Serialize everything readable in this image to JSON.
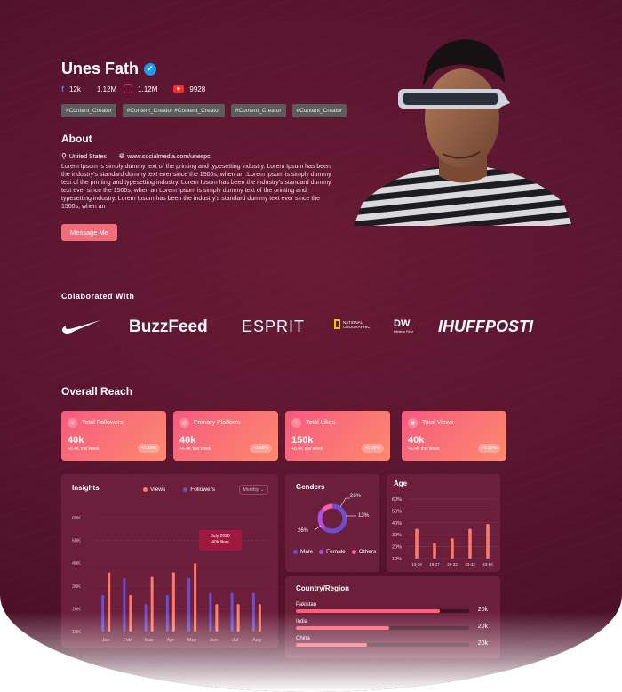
{
  "profile": {
    "name": "Unes Fath",
    "stats": {
      "facebook": "12k",
      "twitter": "1.12M",
      "instagram": "1.12M",
      "youtube": "9928"
    },
    "tags": [
      "#Content_Creator",
      "#Content_Creator",
      "#Content_Creator",
      "#Content_Creator",
      "#Content_Creator"
    ],
    "about_title": "About",
    "location": "United States",
    "website": "www.socialmedia.com/unespc",
    "about_text": "Lorem Ipsum is simply dummy text of the printing and typesetting industry. Lorem Ipsum has been the industry's standard dummy text ever since the 1500s, when an .Lorem Ipsum is simply dummy text of the printing and typesetting industry. Lorem Ipsum has been the industry's standard dummy text ever since the 1500s, when an Lorem Ipsum is simply dummy text of the printing and typesetting industry. Lorem Ipsum has been the industry's standard dummy text ever since the 1500s, when an",
    "message_button": "Message Me"
  },
  "collab": {
    "title": "Colaborated With",
    "brands": [
      "BuzzFeed",
      "ESPRIT",
      "NATIONAL GEOGRAPHIC",
      "DW",
      "IHUFFPOSTI"
    ],
    "brand_sub": {
      "natgeo": "NATIONAL GEOGRAPHIC",
      "dw_sub": "Fitness First"
    }
  },
  "reach": {
    "title": "Overall Reach",
    "kpis": [
      {
        "label": "Total Followers",
        "value": "40k",
        "sub": "+6.4K this week",
        "chip": "+1.29%"
      },
      {
        "label": "Primary Platform",
        "value": "40k",
        "sub": "+6.4K this week",
        "chip": "+1.29%"
      },
      {
        "label": "Total Likes",
        "value": "150k",
        "sub": "+6.4K this week",
        "chip": "+1.29%"
      },
      {
        "label": "Total Views",
        "value": "40k",
        "sub": "+6.4K this week",
        "chip": "+1.29%"
      }
    ]
  },
  "insights": {
    "title": "Insights",
    "legend_views": "Views",
    "legend_followers": "Followers",
    "dropdown": "Monthly",
    "tooltip_title": "July 2020",
    "tooltip_value": "40k likes"
  },
  "genders": {
    "title": "Genders",
    "labels": [
      "Male",
      "Female",
      "Others"
    ],
    "pct_top": "26%",
    "pct_right": "13%",
    "pct_left": "26%"
  },
  "age": {
    "title": "Age"
  },
  "country": {
    "title": "Country/Region",
    "rows": [
      {
        "name": "Pakistan",
        "value": "20k",
        "fill": 0.83
      },
      {
        "name": "India",
        "value": "20k",
        "fill": 0.54
      },
      {
        "name": "China",
        "value": "20k",
        "fill": 0.41
      }
    ]
  },
  "colors": {
    "views": "#ff7a6b",
    "followers": "#6b4fd1",
    "accent": "#f65a7e",
    "male": "#6b4fd1",
    "female": "#b04fe0",
    "others": "#ff5fb0"
  },
  "chart_data": [
    {
      "type": "bar",
      "title": "Insights",
      "categories": [
        "Jan",
        "Feb",
        "Mar",
        "Apr",
        "May",
        "Jun",
        "Jul",
        "Aug"
      ],
      "yticks": [
        "10K",
        "20K",
        "30K",
        "40K",
        "50K",
        "60K"
      ],
      "ylim": [
        10,
        60
      ],
      "series": [
        {
          "name": "Followers",
          "values": [
            26,
            33.5,
            22,
            26,
            33.5,
            27,
            27,
            27
          ]
        },
        {
          "name": "Views",
          "values": [
            36,
            26,
            34,
            36,
            40,
            22,
            22,
            22
          ]
        }
      ],
      "grid": true
    },
    {
      "type": "bar",
      "title": "Age",
      "categories": [
        "13-18",
        "19-27",
        "28-32",
        "33-42",
        "43-56"
      ],
      "yticks": [
        "10%",
        "20%",
        "30%",
        "40%",
        "50%",
        "60%"
      ],
      "ylim": [
        10,
        60
      ],
      "values": [
        35,
        23,
        27,
        35,
        39
      ]
    },
    {
      "type": "pie",
      "title": "Genders",
      "labels": [
        "Male",
        "Female",
        "Others"
      ],
      "values": [
        61,
        26,
        13
      ]
    }
  ]
}
